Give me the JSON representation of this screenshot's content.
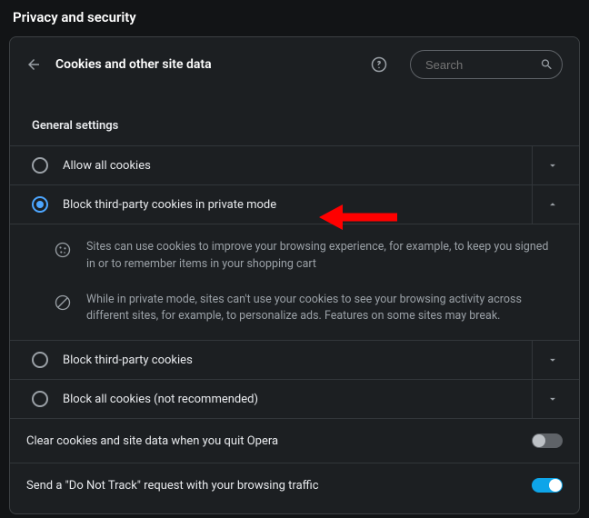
{
  "page": {
    "title": "Privacy and security"
  },
  "panel": {
    "title": "Cookies and other site data",
    "search_placeholder": "Search"
  },
  "general": {
    "heading": "General settings",
    "options": [
      {
        "label": "Allow all cookies"
      },
      {
        "label": "Block third-party cookies in private mode"
      },
      {
        "label": "Block third-party cookies"
      },
      {
        "label": "Block all cookies (not recommended)"
      }
    ],
    "expanded": {
      "line1": "Sites can use cookies to improve your browsing experience, for example, to keep you signed in or to remember items in your shopping cart",
      "line2": "While in private mode, sites can't use your cookies to see your browsing activity across different sites, for example, to personalize ads. Features on some sites may break."
    }
  },
  "toggles": {
    "clear_on_quit": "Clear cookies and site data when you quit Opera",
    "do_not_track": "Send a \"Do Not Track\" request with your browsing traffic"
  }
}
